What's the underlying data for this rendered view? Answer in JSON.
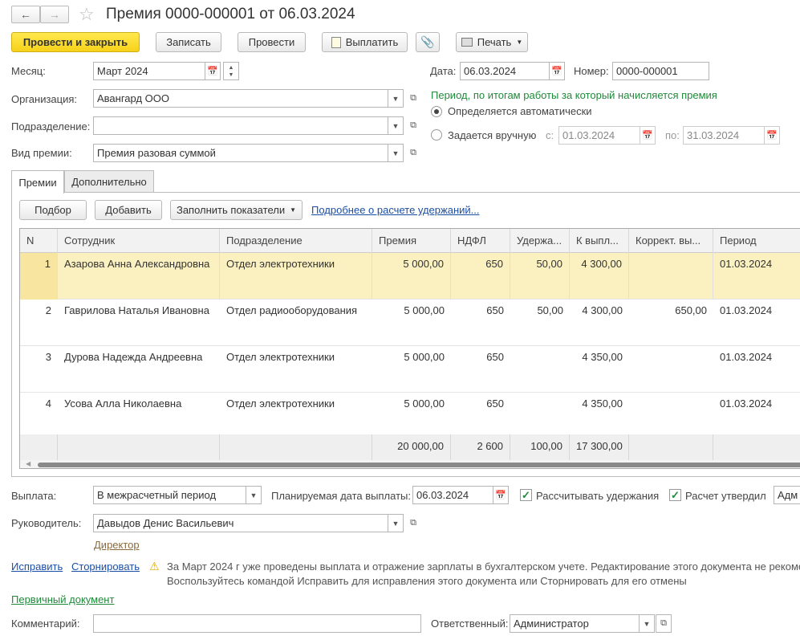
{
  "window": {
    "title": "Премия 0000-000001 от 06.03.2024"
  },
  "toolbar": {
    "post_close": "Провести и закрыть",
    "save": "Записать",
    "post": "Провести",
    "pay": "Выплатить",
    "print": "Печать"
  },
  "form": {
    "month_label": "Месяц:",
    "month_value": "Март 2024",
    "date_label": "Дата:",
    "date_value": "06.03.2024",
    "number_label": "Номер:",
    "number_value": "0000-000001",
    "org_label": "Организация:",
    "org_value": "Авангард ООО",
    "dept_label": "Подразделение:",
    "dept_value": "",
    "bonus_type_label": "Вид премии:",
    "bonus_type_value": "Премия разовая суммой",
    "period_hint": "Период, по итогам работы за который начисляется премия",
    "radio_auto": "Определяется автоматически",
    "radio_manual": "Задается вручную",
    "from_label": "с:",
    "from_value": "01.03.2024",
    "to_label": "по:",
    "to_value": "31.03.2024"
  },
  "tabs": [
    {
      "label": "Премии"
    },
    {
      "label": "Дополнительно"
    }
  ],
  "table_toolbar": {
    "pick": "Подбор",
    "add": "Добавить",
    "fill": "Заполнить показатели",
    "details_link": "Подробнее о расчете удержаний..."
  },
  "table": {
    "columns": [
      "N",
      "Сотрудник",
      "Подразделение",
      "Премия",
      "НДФЛ",
      "Удержа...",
      "К выпл...",
      "Коррект. вы...",
      "Период"
    ],
    "rows": [
      {
        "n": "1",
        "employee": "Азарова Анна Александровна",
        "dept": "Отдел электротехники",
        "bonus": "5 000,00",
        "ndfl": "650",
        "deduct": "50,00",
        "payout": "4 300,00",
        "correct": "",
        "period": "01.03.2024"
      },
      {
        "n": "2",
        "employee": "Гаврилова Наталья Ивановна",
        "dept": "Отдел радиооборудования",
        "bonus": "5 000,00",
        "ndfl": "650",
        "deduct": "50,00",
        "payout": "4 300,00",
        "correct": "650,00",
        "period": "01.03.2024"
      },
      {
        "n": "3",
        "employee": "Дурова Надежда Андреевна",
        "dept": "Отдел электротехники",
        "bonus": "5 000,00",
        "ndfl": "650",
        "deduct": "",
        "payout": "4 350,00",
        "correct": "",
        "period": "01.03.2024"
      },
      {
        "n": "4",
        "employee": "Усова Алла Николаевна",
        "dept": "Отдел электротехники",
        "bonus": "5 000,00",
        "ndfl": "650",
        "deduct": "",
        "payout": "4 350,00",
        "correct": "",
        "period": "01.03.2024"
      }
    ],
    "totals": {
      "bonus": "20 000,00",
      "ndfl": "2 600",
      "deduct": "100,00",
      "payout": "17 300,00"
    }
  },
  "bottom": {
    "payment_label": "Выплата:",
    "payment_value": "В межрасчетный период",
    "plan_date_label": "Планируемая дата выплаты:",
    "plan_date_value": "06.03.2024",
    "calc_deductions": "Рассчитывать удержания",
    "approved": "Расчет утвердил",
    "approved_by": "Адм",
    "manager_label": "Руководитель:",
    "manager_value": "Давыдов Денис Васильевич",
    "manager_position": "Директор",
    "fix_link": "Исправить",
    "reverse_link": "Сторнировать",
    "warning_line1": "За Март 2024 г уже проведены выплата и отражение зарплаты в бухгалтерском учете. Редактирование этого документа не рекоме",
    "warning_line2": "Воспользуйтесь командой Исправить для исправления этого документа или Сторнировать для его отмены",
    "primary_doc_link": "Первичный документ",
    "comment_label": "Комментарий:",
    "comment_value": "",
    "responsible_label": "Ответственный:",
    "responsible_value": "Администратор"
  }
}
